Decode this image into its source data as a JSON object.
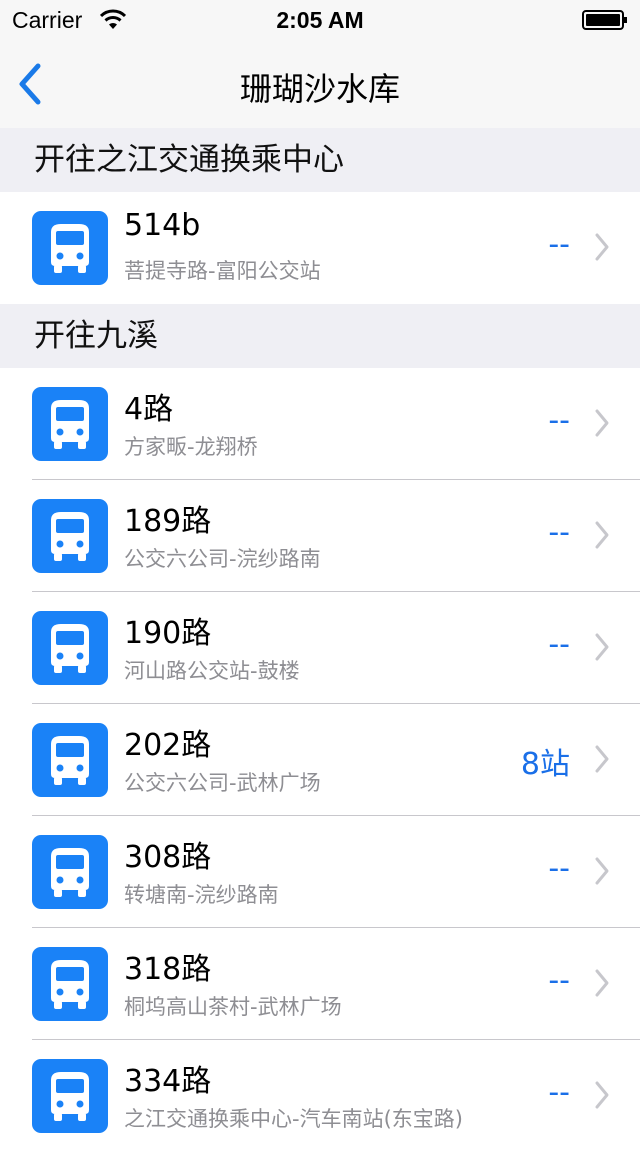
{
  "status_bar": {
    "carrier": "Carrier",
    "time": "2:05 AM"
  },
  "nav": {
    "title": "珊瑚沙水库"
  },
  "sections": [
    {
      "header": "开往之江交通换乘中心",
      "routes": [
        {
          "name": "514b",
          "desc": "菩提寺路-富阳公交站",
          "status": "--"
        }
      ]
    },
    {
      "header": "开往九溪",
      "routes": [
        {
          "name": "4路",
          "desc": "方家畈-龙翔桥",
          "status": "--"
        },
        {
          "name": "189路",
          "desc": "公交六公司-浣纱路南",
          "status": "--"
        },
        {
          "name": "190路",
          "desc": "河山路公交站-鼓楼",
          "status": "--"
        },
        {
          "name": "202路",
          "desc": "公交六公司-武林广场",
          "status": "8站"
        },
        {
          "name": "308路",
          "desc": "转塘南-浣纱路南",
          "status": "--"
        },
        {
          "name": "318路",
          "desc": "桐坞高山茶村-武林广场",
          "status": "--"
        },
        {
          "name": "334路",
          "desc": "之江交通换乘中心-汽车南站(东宝路)",
          "status": "--"
        }
      ]
    }
  ],
  "colors": {
    "accent": "#1a6fe8",
    "icon_bg": "#1a82f7",
    "header_bg": "#efeff4"
  },
  "icons": {
    "route": "bus-icon",
    "disclosure": "chevron-right-icon",
    "back": "chevron-left-icon"
  }
}
